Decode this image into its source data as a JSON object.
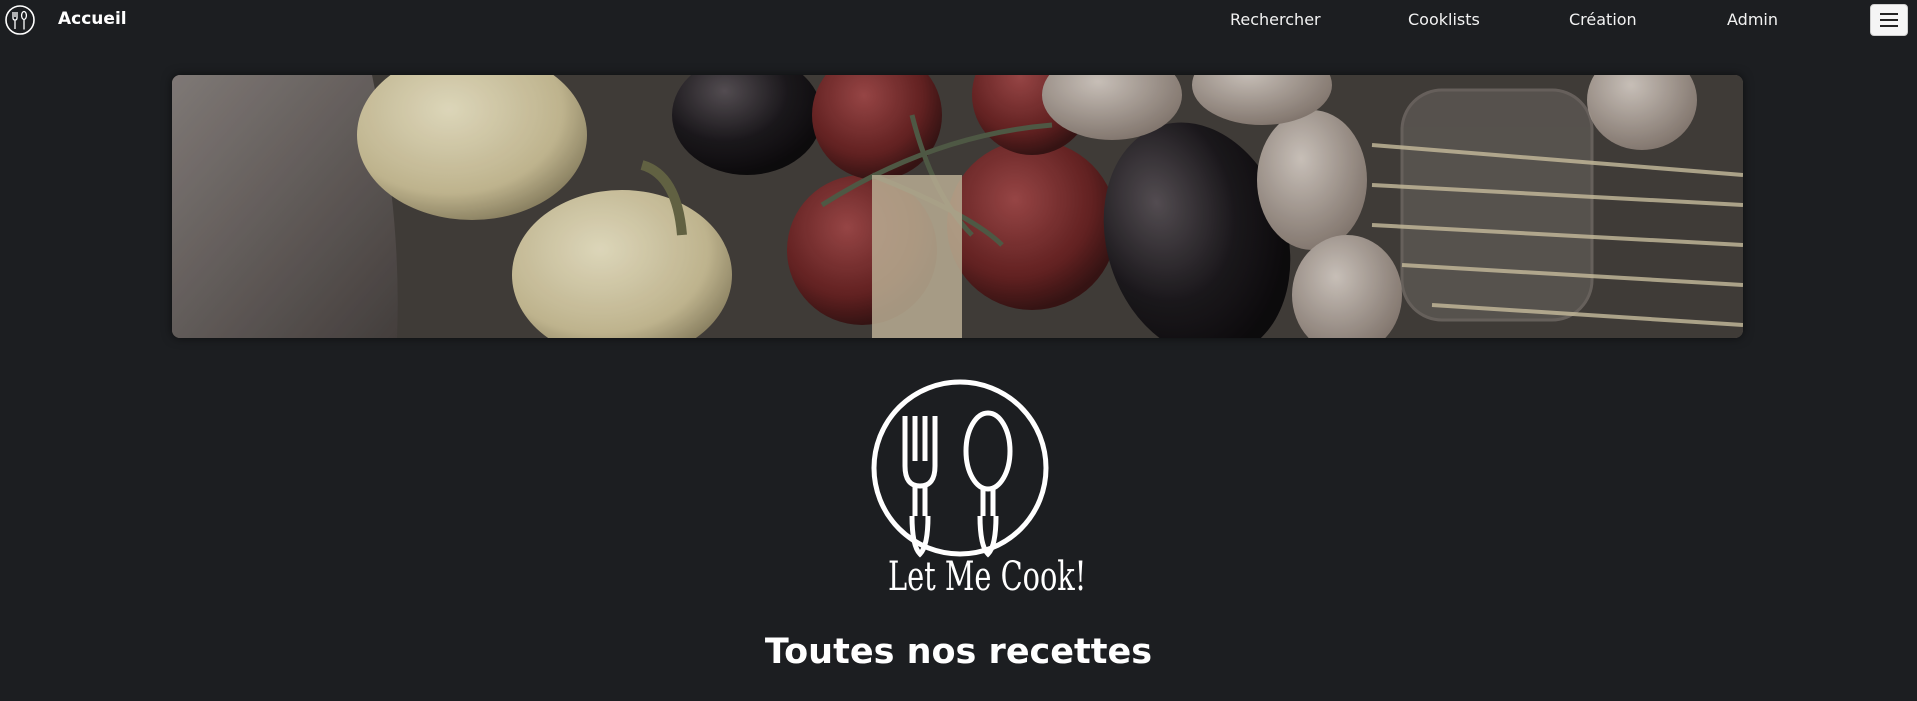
{
  "navbar": {
    "brand_label": "Accueil",
    "links": [
      "Rechercher",
      "Cooklists",
      "Création",
      "Admin"
    ],
    "menu_icon": "hamburger-icon"
  },
  "banner": {
    "image_subject": "vegetables-banner"
  },
  "logo": {
    "title": "Let Me Cook!",
    "icon": "fork-spoon-icon"
  },
  "main": {
    "section_title": "Toutes nos recettes"
  },
  "colors": {
    "background": "#1c1e21",
    "text": "#ffffff",
    "toggle_bg": "#f5f5f5"
  }
}
